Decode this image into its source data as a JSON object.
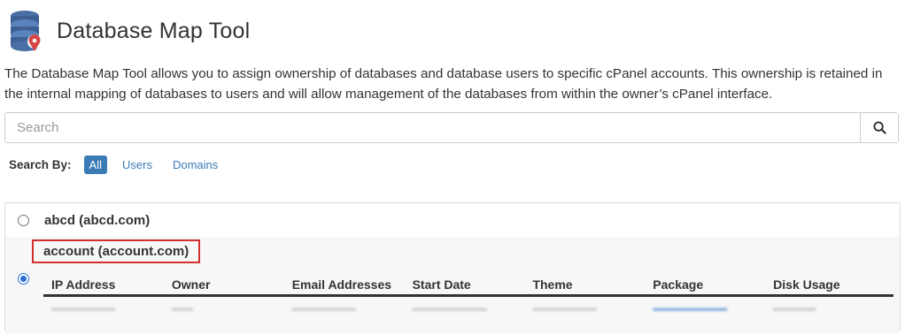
{
  "header": {
    "title": "Database Map Tool",
    "icon": "database-location-icon"
  },
  "description": "The Database Map Tool allows you to assign ownership of databases and database users to specific cPanel accounts. This ownership is retained in the internal mapping of databases to users and will allow management of the databases from within the owner’s cPanel interface.",
  "search": {
    "placeholder": "Search",
    "value": "",
    "button_icon": "search-icon"
  },
  "search_by": {
    "label": "Search By:",
    "options": [
      "All",
      "Users",
      "Domains"
    ],
    "selected": "All"
  },
  "accounts": [
    {
      "label": "abcd (abcd.com)",
      "selected": false
    },
    {
      "label": "account (account.com)",
      "selected": true,
      "columns": [
        "IP Address",
        "Owner",
        "Email Addresses",
        "Start Date",
        "Theme",
        "Package",
        "Disk Usage"
      ]
    }
  ],
  "colors": {
    "accent": "#3a7bb5",
    "highlight_box": "#d32f2f",
    "radio_selected": "#2a6fd6"
  }
}
